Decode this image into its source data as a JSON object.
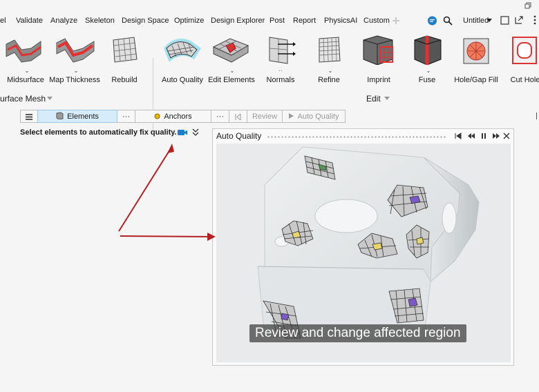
{
  "menubar": {
    "items": [
      "el",
      "Validate",
      "Analyze",
      "Skeleton",
      "Design Space",
      "Optimize",
      "Design Explorer",
      "Post",
      "Report",
      "PhysicsAI",
      "Custom"
    ],
    "file_name": "Untitled"
  },
  "ribbon": {
    "tools": [
      "Midsurface",
      "Map Thickness",
      "Rebuild",
      "Auto Quality",
      "Edit Elements",
      "Normals",
      "Refine",
      "Imprint",
      "Fuse",
      "Hole/Gap Fill",
      "Cut Hole"
    ],
    "groups": {
      "left": "urface Mesh",
      "edit": "Edit"
    }
  },
  "toolbar2": {
    "elements": "Elements",
    "anchors": "Anchors",
    "more": "···",
    "review": "Review",
    "auto_quality": "Auto Quality"
  },
  "status": {
    "text": "Select elements to automatically fix quality."
  },
  "panel": {
    "title": "Auto Quality",
    "caption": "Review and change affected region"
  },
  "colors": {
    "accent": "#1a7fc8",
    "arrow": "#b22222",
    "active": "#d7ecfa"
  }
}
